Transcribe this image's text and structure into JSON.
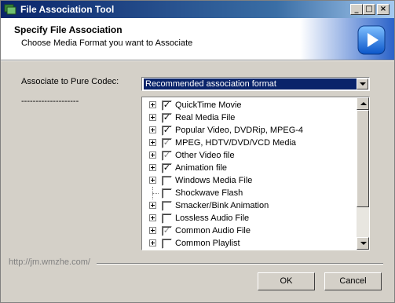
{
  "window": {
    "title": "File Association Tool"
  },
  "header": {
    "title": "Specify File Association",
    "subtitle": "Choose Media Format you want to Associate"
  },
  "codec": {
    "label": "Associate to Pure Codec:",
    "selected": "Recommended association format",
    "separator_text": "--------------------"
  },
  "formats": [
    {
      "label": "QuickTime Movie",
      "expandable": true,
      "checked": true,
      "grey": false
    },
    {
      "label": "Real Media File",
      "expandable": true,
      "checked": true,
      "grey": false
    },
    {
      "label": "Popular Video, DVDRip, MPEG-4",
      "expandable": true,
      "checked": true,
      "grey": false
    },
    {
      "label": "MPEG, HDTV/DVD/VCD Media",
      "expandable": true,
      "checked": true,
      "grey": true
    },
    {
      "label": "Other Video file",
      "expandable": true,
      "checked": true,
      "grey": true
    },
    {
      "label": "Animation file",
      "expandable": true,
      "checked": true,
      "grey": false
    },
    {
      "label": "Windows Media File",
      "expandable": true,
      "checked": false,
      "grey": false
    },
    {
      "label": "Shockwave Flash",
      "expandable": false,
      "checked": false,
      "grey": false
    },
    {
      "label": "Smacker/Bink Animation",
      "expandable": true,
      "checked": false,
      "grey": false
    },
    {
      "label": "Lossless Audio File",
      "expandable": true,
      "checked": false,
      "grey": false
    },
    {
      "label": "Common Audio File",
      "expandable": true,
      "checked": true,
      "grey": true
    },
    {
      "label": "Common Playlist",
      "expandable": true,
      "checked": false,
      "grey": false
    }
  ],
  "footer": {
    "url": "http://jm.wmzhe.com/",
    "ok_label": "OK",
    "cancel_label": "Cancel"
  },
  "colors": {
    "title_bar": "#0a246a",
    "selection": "#0a246a",
    "face": "#d4d0c8"
  }
}
